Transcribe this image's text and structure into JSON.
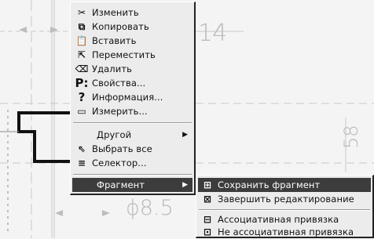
{
  "drawing": {
    "dimension_top": "14",
    "dimension_bottom": "ϕ8.5",
    "dimension_right": "58"
  },
  "context_menu": {
    "items": [
      {
        "label": "Изменить",
        "icon": "edit-icon"
      },
      {
        "label": "Копировать",
        "icon": "copy-icon"
      },
      {
        "label": "Вставить",
        "icon": "paste-icon"
      },
      {
        "label": "Переместить",
        "icon": "move-icon"
      },
      {
        "label": "Удалить",
        "icon": "delete-icon"
      },
      {
        "label": "Свойства...",
        "icon": "properties-icon"
      },
      {
        "label": "Информация...",
        "icon": "info-icon"
      },
      {
        "label": "Измерить...",
        "icon": "measure-icon"
      },
      {
        "label": "Другой",
        "icon": ""
      },
      {
        "label": "Выбрать все",
        "icon": "select-all-icon"
      },
      {
        "label": "Селектор...",
        "icon": "selector-icon"
      },
      {
        "label": "Фрагмент",
        "icon": ""
      }
    ]
  },
  "sub_menu": {
    "items": [
      {
        "label": "Сохранить фрагмент",
        "icon": "save-fragment-icon"
      },
      {
        "label": "Завершить редактирование",
        "icon": "finish-edit-icon"
      },
      {
        "label": "Ассоциативная привязка",
        "icon": "associative-link-icon"
      },
      {
        "label": "Не ассоциативная привязка",
        "icon": "non-associative-link-icon"
      }
    ]
  }
}
